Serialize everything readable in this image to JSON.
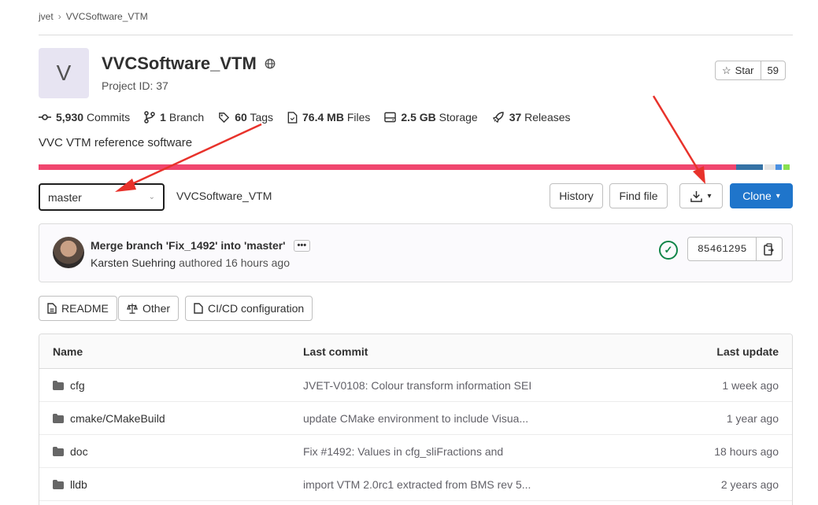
{
  "breadcrumb": {
    "group": "jvet",
    "project": "VVCSoftware_VTM"
  },
  "project": {
    "avatar_letter": "V",
    "title": "VVCSoftware_VTM",
    "id_label": "Project ID: 37",
    "description": "VVC VTM reference software"
  },
  "star": {
    "label": "Star",
    "count": "59"
  },
  "stats": [
    {
      "icon": "commit-icon",
      "value": "5,930",
      "label": "Commits"
    },
    {
      "icon": "branch-icon",
      "value": "1",
      "label": "Branch"
    },
    {
      "icon": "tag-icon",
      "value": "60",
      "label": "Tags"
    },
    {
      "icon": "file-icon",
      "value": "76.4 MB",
      "label": "Files"
    },
    {
      "icon": "storage-icon",
      "value": "2.5 GB",
      "label": "Storage"
    },
    {
      "icon": "rocket-icon",
      "value": "37",
      "label": "Releases"
    }
  ],
  "language_colors": [
    "#f0466e",
    "#3572a5",
    "#e3e3e3",
    "#4a90e2",
    "#89e051"
  ],
  "toolbar": {
    "branch": "master",
    "path": "VVCSoftware_VTM",
    "history": "History",
    "find_file": "Find file",
    "clone": "Clone"
  },
  "last_commit": {
    "message": "Merge branch 'Fix_1492' into 'master'",
    "author": "Karsten Suehring",
    "action": "authored",
    "time": "16 hours ago",
    "sha": "85461295",
    "status": "passed"
  },
  "shortcuts": [
    {
      "icon": "readme-icon",
      "label": "README"
    },
    {
      "icon": "scale-icon",
      "label": "Other"
    },
    {
      "icon": "file-icon",
      "label": "CI/CD configuration"
    }
  ],
  "table": {
    "headers": [
      "Name",
      "Last commit",
      "Last update"
    ],
    "rows": [
      {
        "name": "cfg",
        "commit": "JVET-V0108: Colour transform information SEI",
        "updated": "1 week ago"
      },
      {
        "name": "cmake/CMakeBuild",
        "commit": "update CMake environment to include Visua...",
        "updated": "1 year ago"
      },
      {
        "name": "doc",
        "commit": "Fix #1492: Values in cfg_sliFractions and",
        "updated": "18 hours ago"
      },
      {
        "name": "lldb",
        "commit": "import VTM 2.0rc1 extracted from BMS rev 5...",
        "updated": "2 years ago"
      }
    ]
  }
}
